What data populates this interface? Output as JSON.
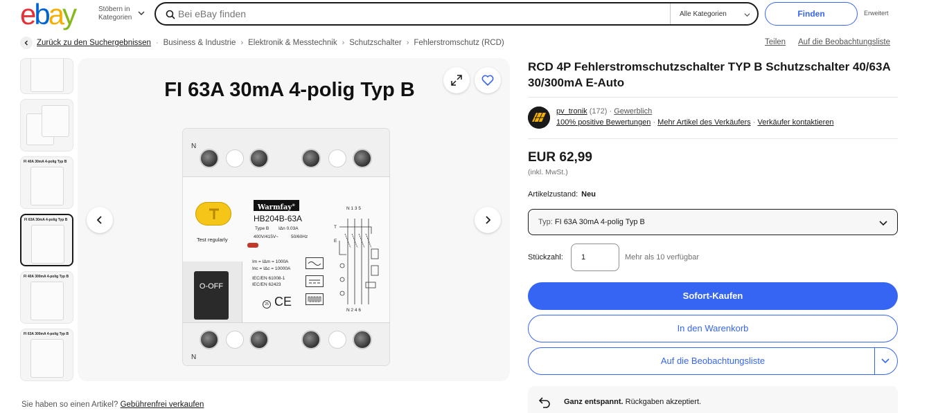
{
  "header": {
    "logo_letters": [
      "e",
      "b",
      "a",
      "y"
    ],
    "browse_label": "Stöbern in Kategorien",
    "search_placeholder": "Bei eBay finden",
    "category_select": "Alle Kategorien",
    "find_button": "Finden",
    "advanced_link": "Erweitert"
  },
  "breadcrumb": {
    "back_link": "Zurück zu den Suchergebnissen",
    "items": [
      "Business & Industrie",
      "Elektronik & Messtechnik",
      "Schutzschalter",
      "Fehlerstromschutz (RCD)"
    ],
    "share_link": "Teilen",
    "watchlist_link": "Auf die Beobachtungsliste"
  },
  "gallery": {
    "thumbnails": [
      {
        "label": ""
      },
      {
        "label": ""
      },
      {
        "label": "FI 40A 30mA 4-polig Typ B"
      },
      {
        "label": "FI 63A 30mA 4-polig Typ B"
      },
      {
        "label": "FI 40A 300mA 4-polig Typ B"
      },
      {
        "label": "FI 63A 300mA 4-polig Typ B"
      }
    ],
    "active_thumbnail_index": 3,
    "image_title": "FI 63A 30mA 4-polig Typ B",
    "device": {
      "letter_top": "N",
      "letter_bottom": "N",
      "test_label": "Test regularly",
      "brand": "Warmfay",
      "brand_mark": "®",
      "model": "HB204B-63A",
      "type": "Type B",
      "idn": "IΔn 0.03A",
      "voltage": "400V/415V~",
      "frequency": "50/60Hz",
      "lever": "O-OFF",
      "spec1": "Im = IΔm = 1000A",
      "spec2": "Inc = IΔc = 10000A",
      "spec3": "IEC/EN 61008-1",
      "spec4": "IEC/EN 62423",
      "ce_mark": "CE",
      "temp_mark": "25",
      "terminals_top": "N 1 3 5",
      "terminals_bottom": "N 2 4 6",
      "diagram_t": "T",
      "diagram_e": "E"
    }
  },
  "sell_prompt": {
    "text": "Sie haben so einen Artikel?",
    "link": "Gebührenfrei verkaufen"
  },
  "listing": {
    "title": "RCD 4P Fehlerstromschutzschalter TYP B Schutzschalter 40/63A 30/300mA E-Auto",
    "seller": {
      "name": "pv_tronik",
      "feedback_count": "(172)",
      "type": "Gewerblich",
      "positive": "100% positive Bewertungen",
      "more_items": "Mehr Artikel des Verkäufers",
      "contact": "Verkäufer kontaktieren"
    },
    "price": "EUR 62,99",
    "vat": "(inkl. MwSt.)",
    "condition_label": "Artikelzustand:",
    "condition_value": "Neu",
    "type_label": "Typ:",
    "type_value": "FI 63A 30mA 4-polig Typ B",
    "quantity_label": "Stückzahl:",
    "quantity_value": "1",
    "availability": "Mehr als 10 verfügbar",
    "buy_now": "Sofort-Kaufen",
    "add_to_cart": "In den Warenkorb",
    "add_to_watchlist": "Auf die Beobachtungsliste",
    "returns_bold": "Ganz entspannt.",
    "returns_text": "Rückgaben akzeptiert."
  },
  "colors": {
    "accent": "#3665f3",
    "logo_red": "#e53238",
    "logo_blue": "#0064d2",
    "logo_yellow": "#f5af02",
    "logo_green": "#86b817"
  }
}
